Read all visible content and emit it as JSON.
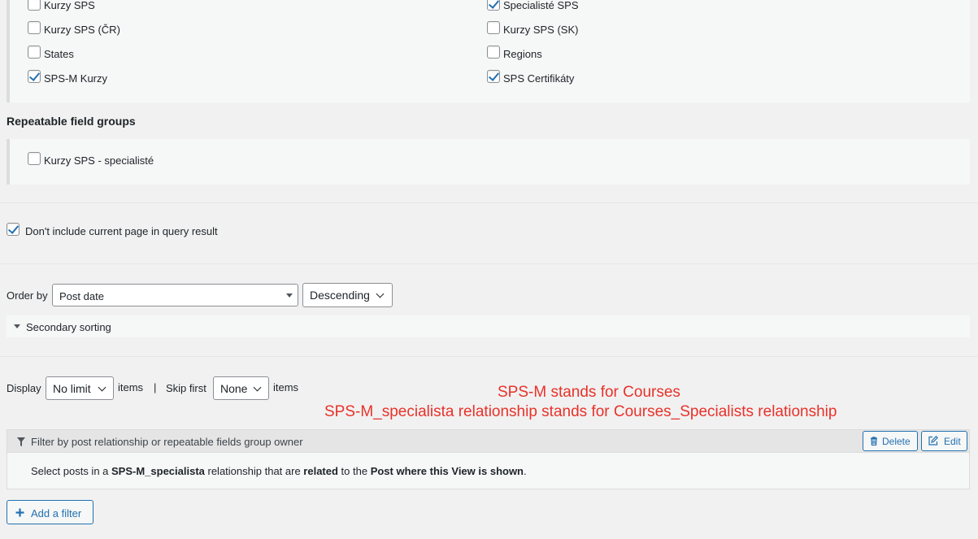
{
  "post_types": {
    "left": [
      {
        "label": "Kurzy SPS",
        "checked": false
      },
      {
        "label": "Kurzy SPS (ČR)",
        "checked": false
      },
      {
        "label": "States",
        "checked": false
      },
      {
        "label": "SPS-M Kurzy",
        "checked": true
      }
    ],
    "right": [
      {
        "label": "Specialisté SPS",
        "checked": true
      },
      {
        "label": "Kurzy SPS (SK)",
        "checked": false
      },
      {
        "label": "Regions",
        "checked": false
      },
      {
        "label": "SPS Certifikáty",
        "checked": true
      }
    ]
  },
  "repeatable": {
    "heading": "Repeatable field groups",
    "items": [
      {
        "label": "Kurzy SPS - specialisté",
        "checked": false
      }
    ]
  },
  "exclude_current": {
    "label": "Don't include current page in query result",
    "checked": true
  },
  "order": {
    "label": "Order by",
    "field_value": "Post date",
    "direction_value": "Descending",
    "secondary_label": "Secondary sorting"
  },
  "limit": {
    "display_label": "Display",
    "display_value": "No limit",
    "items_label": "items",
    "separator": "|",
    "skip_label": "Skip first",
    "skip_value": "None",
    "items_label_2": "items"
  },
  "annotation": {
    "line1": "SPS-M stands for Courses",
    "line2": "SPS-M_specialista relationship stands for Courses_Specialists relationship",
    "color": "#e8322a"
  },
  "filter": {
    "title": "Filter by post relationship or repeatable fields group owner",
    "delete_label": "Delete",
    "edit_label": "Edit",
    "desc": {
      "p1": "Select posts in a ",
      "b1": "SPS-M_specialista",
      "p2": " relationship that are ",
      "b2": "related",
      "p3": " to the ",
      "b3": "Post where this View is shown",
      "p4": "."
    }
  },
  "add_filter_label": "Add a filter",
  "colors": {
    "accent": "#2271b1",
    "panel": "#f6f7f7",
    "background": "#f1f1f1"
  }
}
